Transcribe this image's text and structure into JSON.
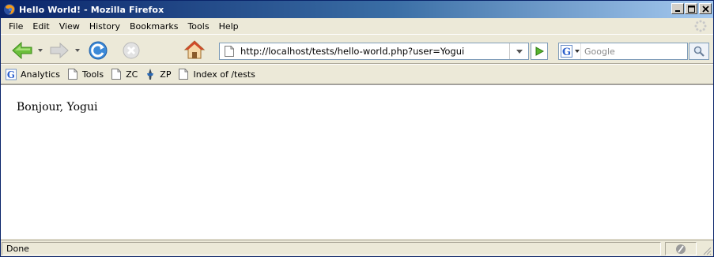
{
  "window": {
    "title": "Hello World! - Mozilla Firefox"
  },
  "menu": {
    "items": [
      "File",
      "Edit",
      "View",
      "History",
      "Bookmarks",
      "Tools",
      "Help"
    ]
  },
  "navigation": {
    "url": "http://localhost/tests/hello-world.php?user=Yogui",
    "search_placeholder": "Google"
  },
  "bookmarks": {
    "items": [
      "Analytics",
      "Tools",
      "ZC",
      "ZP",
      "Index of /tests"
    ]
  },
  "page": {
    "text": "Bonjour, Yogui"
  },
  "status": {
    "text": "Done"
  },
  "colors": {
    "titlebar_start": "#0a246a",
    "titlebar_end": "#a6caf0",
    "chrome": "#ece9d8"
  }
}
